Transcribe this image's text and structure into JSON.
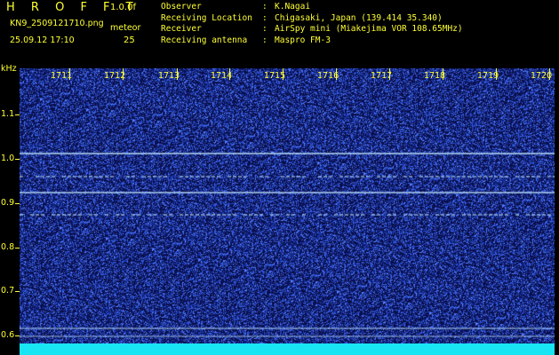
{
  "header": {
    "logo": "HROFFT",
    "version": "1.0.0f",
    "filename": "KN9_2509121710.png",
    "datetime": "25.09.12 17:10",
    "meteor_label": "meteor",
    "meteor_count": "25"
  },
  "info": [
    {
      "key": "Observer",
      "value": "K.Nagai"
    },
    {
      "key": "Receiving Location",
      "value": "Chigasaki, Japan (139.414 35.340)"
    },
    {
      "key": "Receiver",
      "value": "AirSpy mini (Miakejima VOR 108.65MHz)"
    },
    {
      "key": "Receiving antenna",
      "value": "Maspro FM-3"
    }
  ],
  "axis": {
    "unit": "kHz",
    "y_labels": [
      "1.1",
      "1.0",
      "0.9",
      "0.8",
      "0.7",
      "0.6"
    ],
    "x_labels": [
      "1711",
      "1712",
      "1713",
      "1714",
      "1715",
      "1716",
      "1717",
      "1718",
      "1719",
      "1720"
    ]
  },
  "colors": {
    "label": "#ffff33",
    "background": "#0a0f4a",
    "noise": "#3a5cff",
    "signal": "#bfe6ff",
    "bottom_band": "#19e4f4"
  }
}
